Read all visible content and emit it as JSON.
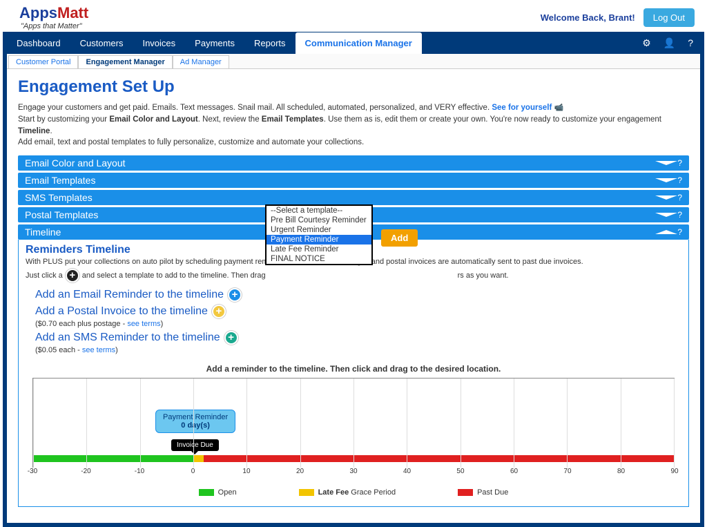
{
  "header": {
    "logo_prefix": "Apps",
    "logo_suffix": "Matt",
    "tagline": "\"Apps that Matter\"",
    "welcome": "Welcome Back, Brant!",
    "logout": "Log Out"
  },
  "nav": {
    "items": [
      "Dashboard",
      "Customers",
      "Invoices",
      "Payments",
      "Reports",
      "Communication Manager"
    ],
    "active_index": 5,
    "icons": {
      "settings": "gear-icon",
      "user": "user-icon",
      "help": "help-icon"
    }
  },
  "subtabs": {
    "items": [
      "Customer Portal",
      "Engagement Manager",
      "Ad Manager"
    ],
    "active_index": 1
  },
  "page": {
    "title": "Engagement Set Up",
    "intro_l1a": "Engage your customers and get paid. Emails. Text messages. Snail mail. All scheduled, automated, personalized, and VERY effective. ",
    "intro_link": "See for yourself",
    "intro_l2a": "Start by customizing your ",
    "intro_l2b": "Email Color and Layout",
    "intro_l2c": ". Next, review the ",
    "intro_l2d": "Email Templates",
    "intro_l2e": ". Use them as is, edit them or create your own. You're now ready to customize your engagement ",
    "intro_l2f": "Timeline",
    "intro_l2g": ".",
    "intro_l3": "Add email, text and postal templates to fully personalize, customize and automate your collections."
  },
  "accordions": [
    "Email Color and Layout",
    "Email Templates",
    "SMS Templates",
    "Postal Templates",
    "Timeline"
  ],
  "timeline": {
    "title": "Reminders Timeline",
    "desc": "With PLUS put your collections on auto pilot by scheduling payment reminders. Emails, text messages and postal invoices are automatically sent to past due invoices.",
    "just_a": "Just click a ",
    "just_b": " and select a template to add to the timeline. Then drag",
    "just_c": "rs as you want.",
    "add_email": "Add an Email Reminder to the timeline",
    "add_postal": "Add a Postal Invoice to the timeline",
    "postal_sub_a": "($0.70 each plus postage - ",
    "add_sms": "Add an SMS Reminder to the timeline",
    "sms_sub_a": "($0.05 each - ",
    "see_terms": "see terms",
    "sub_close": ")",
    "caption": "Add a reminder to the timeline. Then click and drag to the desired location.",
    "bubble_title": "Payment Reminder",
    "bubble_days": "0 day(s)",
    "invoice_due": "Invoice Due"
  },
  "select": {
    "placeholder": "--Select a template--",
    "options": [
      "Pre Bill Courtesy Reminder",
      "Urgent Reminder",
      "Payment Reminder",
      "Late Fee Reminder",
      "FINAL NOTICE"
    ],
    "selected_index": 2,
    "add_button": "Add"
  },
  "legend": {
    "open": "Open",
    "late_a": "Late Fee ",
    "late_b": "Grace Period",
    "past": "Past Due"
  },
  "chart_data": {
    "type": "bar",
    "xlabel": "",
    "ylabel": "",
    "x_range": [
      -30,
      90
    ],
    "ticks": [
      -30,
      -20,
      -10,
      0,
      10,
      20,
      30,
      40,
      50,
      60,
      70,
      80,
      90
    ],
    "segments": [
      {
        "name": "Open",
        "from": -30,
        "to": 0,
        "color": "#1fc41f"
      },
      {
        "name": "Late Fee Grace Period",
        "from": 0,
        "to": 2,
        "color": "#f2c400"
      },
      {
        "name": "Past Due",
        "from": 2,
        "to": 90,
        "color": "#e02020"
      }
    ],
    "markers": [
      {
        "label": "Payment Reminder",
        "days": 0
      },
      {
        "label": "Invoice Due",
        "at": 0
      }
    ]
  }
}
